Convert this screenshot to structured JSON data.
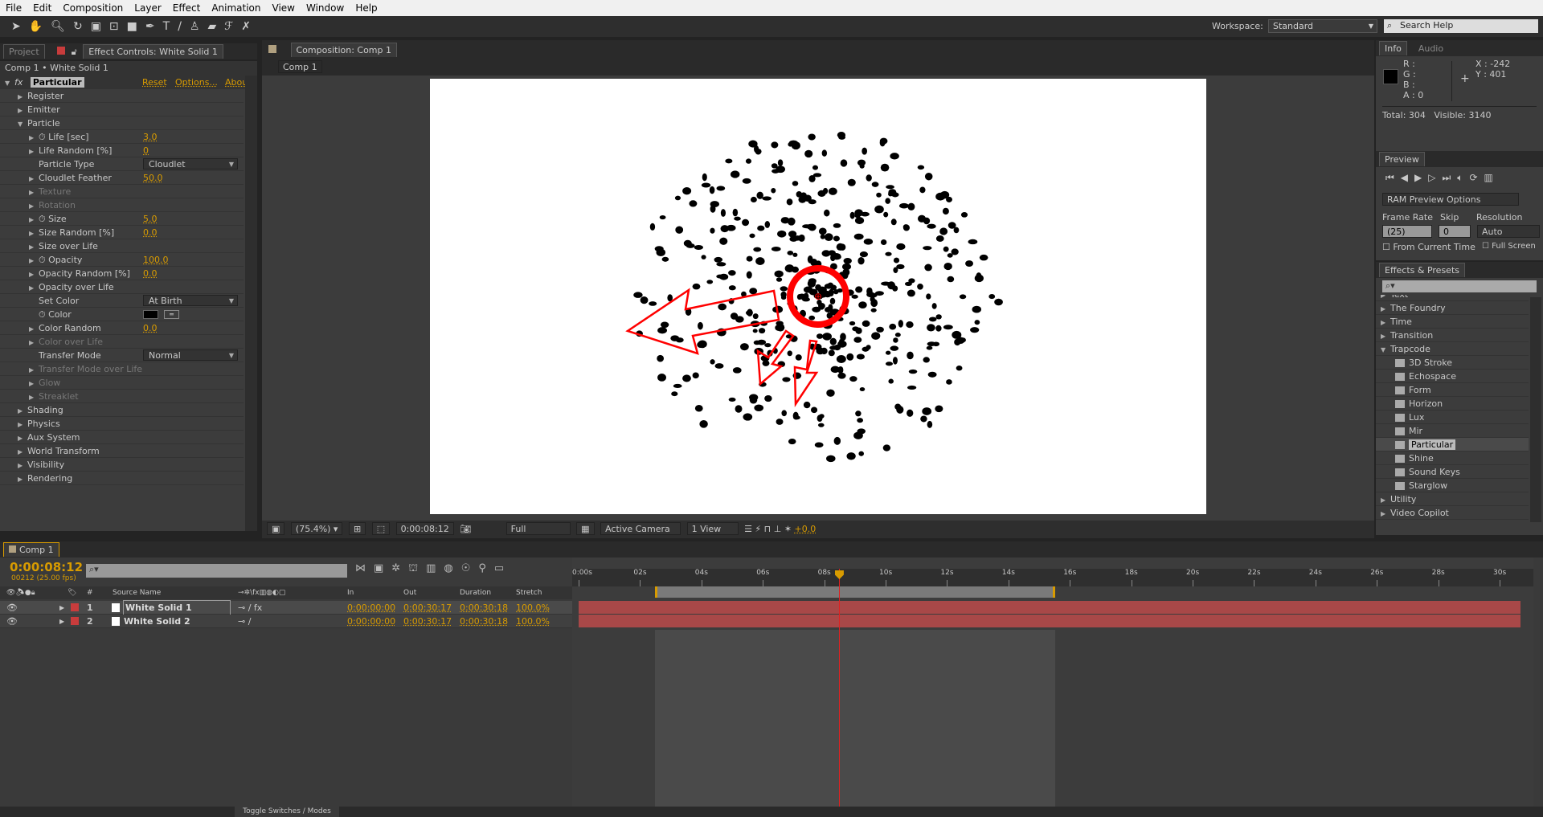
{
  "menu": [
    "File",
    "Edit",
    "Composition",
    "Layer",
    "Effect",
    "Animation",
    "View",
    "Window",
    "Help"
  ],
  "toolbar": {
    "workspace_label": "Workspace:",
    "workspace_value": "Standard",
    "search_placeholder": "Search Help",
    "tools": [
      "selection-tool",
      "hand-tool",
      "zoom-tool",
      "rotation-tool",
      "camera-tool",
      "pan-behind-tool",
      "rectangle-tool",
      "pen-tool",
      "type-tool",
      "brush-tool",
      "clone-stamp-tool",
      "eraser-tool",
      "roto-brush-tool",
      "puppet-tool"
    ]
  },
  "effect_controls": {
    "tab_project": "Project",
    "tab_title": "Effect Controls: White Solid 1",
    "breadcrumb": "Comp 1 • White Solid 1",
    "effect_name": "Particular",
    "reset": "Reset",
    "options": "Options...",
    "about": "Abou",
    "rows": [
      {
        "label": "Register",
        "level": 1,
        "arrow": "right"
      },
      {
        "label": "Emitter",
        "level": 1,
        "arrow": "right"
      },
      {
        "label": "Particle",
        "level": 1,
        "arrow": "down"
      },
      {
        "label": "Life [sec]",
        "level": 2,
        "arrow": "right",
        "stopwatch": true,
        "value": "3.0"
      },
      {
        "label": "Life Random [%]",
        "level": 2,
        "arrow": "right",
        "value": "0"
      },
      {
        "label": "Particle Type",
        "level": 2,
        "dropdown": "Cloudlet"
      },
      {
        "label": "Cloudlet Feather",
        "level": 2,
        "arrow": "right",
        "value": "50.0"
      },
      {
        "label": "Texture",
        "level": 2,
        "arrow": "right",
        "disabled": true
      },
      {
        "label": "Rotation",
        "level": 2,
        "arrow": "right",
        "disabled": true
      },
      {
        "label": "Size",
        "level": 2,
        "arrow": "right",
        "stopwatch": true,
        "value": "5.0"
      },
      {
        "label": "Size Random [%]",
        "level": 2,
        "arrow": "right",
        "value": "0.0"
      },
      {
        "label": "Size over Life",
        "level": 2,
        "arrow": "right"
      },
      {
        "label": "Opacity",
        "level": 2,
        "arrow": "right",
        "stopwatch": true,
        "value": "100.0"
      },
      {
        "label": "Opacity Random [%]",
        "level": 2,
        "arrow": "right",
        "value": "0.0"
      },
      {
        "label": "Opacity over Life",
        "level": 2,
        "arrow": "right"
      },
      {
        "label": "Set Color",
        "level": 2,
        "dropdown": "At Birth"
      },
      {
        "label": "Color",
        "level": 2,
        "stopwatch": true,
        "swatch": "#000000"
      },
      {
        "label": "Color Random",
        "level": 2,
        "arrow": "right",
        "value": "0.0"
      },
      {
        "label": "Color over Life",
        "level": 2,
        "arrow": "right",
        "disabled": true
      },
      {
        "label": "Transfer Mode",
        "level": 2,
        "dropdown": "Normal"
      },
      {
        "label": "Transfer Mode over Life",
        "level": 2,
        "arrow": "right",
        "disabled": true
      },
      {
        "label": "Glow",
        "level": 2,
        "arrow": "right",
        "disabled": true
      },
      {
        "label": "Streaklet",
        "level": 2,
        "arrow": "right",
        "disabled": true
      },
      {
        "label": "Shading",
        "level": 1,
        "arrow": "right"
      },
      {
        "label": "Physics",
        "level": 1,
        "arrow": "right"
      },
      {
        "label": "Aux System",
        "level": 1,
        "arrow": "right"
      },
      {
        "label": "World Transform",
        "level": 1,
        "arrow": "right"
      },
      {
        "label": "Visibility",
        "level": 1,
        "arrow": "right"
      },
      {
        "label": "Rendering",
        "level": 1,
        "arrow": "right"
      }
    ]
  },
  "composition": {
    "tab_title": "Composition: Comp 1",
    "comp_tab": "Comp 1",
    "zoom": "(75.4%)",
    "timecode": "0:00:08:12",
    "resolution": "Full",
    "camera": "Active Camera",
    "views": "1 View",
    "exposure": "+0.0"
  },
  "info": {
    "tab": "Info",
    "tab_audio": "Audio",
    "r": "R :",
    "g": "G :",
    "b": "B :",
    "a": "A : 0",
    "x": "X : -242",
    "y": "Y : 401",
    "totals": "Total: 304   Visible: 3140"
  },
  "preview": {
    "tab": "Preview",
    "ram_options": "RAM Preview Options",
    "frame_rate_label": "Frame Rate",
    "frame_rate": "(25)",
    "skip_label": "Skip",
    "skip": "0",
    "resolution_label": "Resolution",
    "resolution": "Auto",
    "from_current": "From Current Time",
    "full_screen": "Full Screen"
  },
  "effects_presets": {
    "tab": "Effects & Presets",
    "search_placeholder": "",
    "items": [
      {
        "label": "Text",
        "type": "folder",
        "partial": true
      },
      {
        "label": "The Foundry",
        "type": "folder"
      },
      {
        "label": "Time",
        "type": "folder"
      },
      {
        "label": "Transition",
        "type": "folder"
      },
      {
        "label": "Trapcode",
        "type": "folder",
        "open": true
      },
      {
        "label": "3D Stroke",
        "type": "effect"
      },
      {
        "label": "Echospace",
        "type": "effect"
      },
      {
        "label": "Form",
        "type": "effect"
      },
      {
        "label": "Horizon",
        "type": "effect"
      },
      {
        "label": "Lux",
        "type": "effect"
      },
      {
        "label": "Mir",
        "type": "effect"
      },
      {
        "label": "Particular",
        "type": "effect",
        "selected": true
      },
      {
        "label": "Shine",
        "type": "effect"
      },
      {
        "label": "Sound Keys",
        "type": "effect"
      },
      {
        "label": "Starglow",
        "type": "effect"
      },
      {
        "label": "Utility",
        "type": "folder"
      },
      {
        "label": "Video Copilot",
        "type": "folder"
      }
    ]
  },
  "timeline": {
    "tab": "Comp 1",
    "timecode": "0:00:08:12",
    "frame_info": "00212 (25.00 fps)",
    "columns": {
      "num": "#",
      "source": "Source Name",
      "in": "In",
      "out": "Out",
      "duration": "Duration",
      "stretch": "Stretch"
    },
    "ruler": [
      "0:00s",
      "02s",
      "04s",
      "06s",
      "08s",
      "10s",
      "12s",
      "14s",
      "16s",
      "18s",
      "20s",
      "22s",
      "24s",
      "26s",
      "28s",
      "30s"
    ],
    "playhead_seconds": 8.48,
    "work_area_seconds": [
      3,
      16
    ],
    "layers": [
      {
        "num": "1",
        "name": "White Solid 1",
        "label_color": "#c83c3c",
        "in": "0:00:00:00",
        "out": "0:00:30:17",
        "duration": "0:00:30:18",
        "stretch": "100.0%",
        "fx": true,
        "selected": true
      },
      {
        "num": "2",
        "name": "White Solid 2",
        "label_color": "#c83c3c",
        "in": "0:00:00:00",
        "out": "0:00:30:17",
        "duration": "0:00:30:18",
        "stretch": "100.0%",
        "fx": false
      }
    ],
    "toggle_label": "Toggle Switches / Modes"
  },
  "colors": {
    "accent": "#d89b00",
    "annotation": "#ff0000",
    "layer_bar": "#a84848"
  }
}
